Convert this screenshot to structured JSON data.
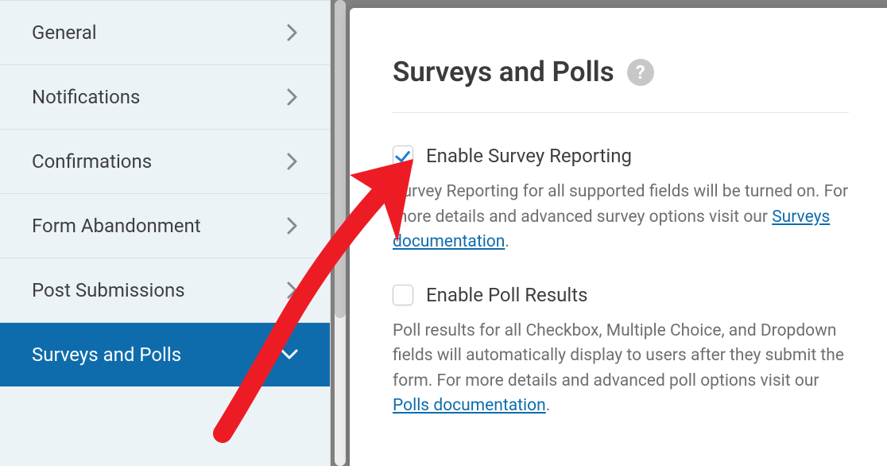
{
  "sidebar": {
    "items": [
      {
        "label": "General"
      },
      {
        "label": "Notifications"
      },
      {
        "label": "Confirmations"
      },
      {
        "label": "Form Abandonment"
      },
      {
        "label": "Post Submissions"
      },
      {
        "label": "Surveys and Polls"
      }
    ]
  },
  "panel": {
    "title": "Surveys and Polls",
    "options": {
      "survey": {
        "label": "Enable Survey Reporting",
        "desc_pre": "Survey Reporting for all supported fields will be turned on. For more details and advanced survey options visit our ",
        "link": "Surveys documentation",
        "desc_post": "."
      },
      "polls": {
        "label": "Enable Poll Results",
        "desc_pre": "Poll results for all Checkbox, Multiple Choice, and Dropdown fields will automatically display to users after they submit the form. For more details and advanced poll options visit our ",
        "link": "Polls documentation",
        "desc_post": "."
      }
    }
  }
}
